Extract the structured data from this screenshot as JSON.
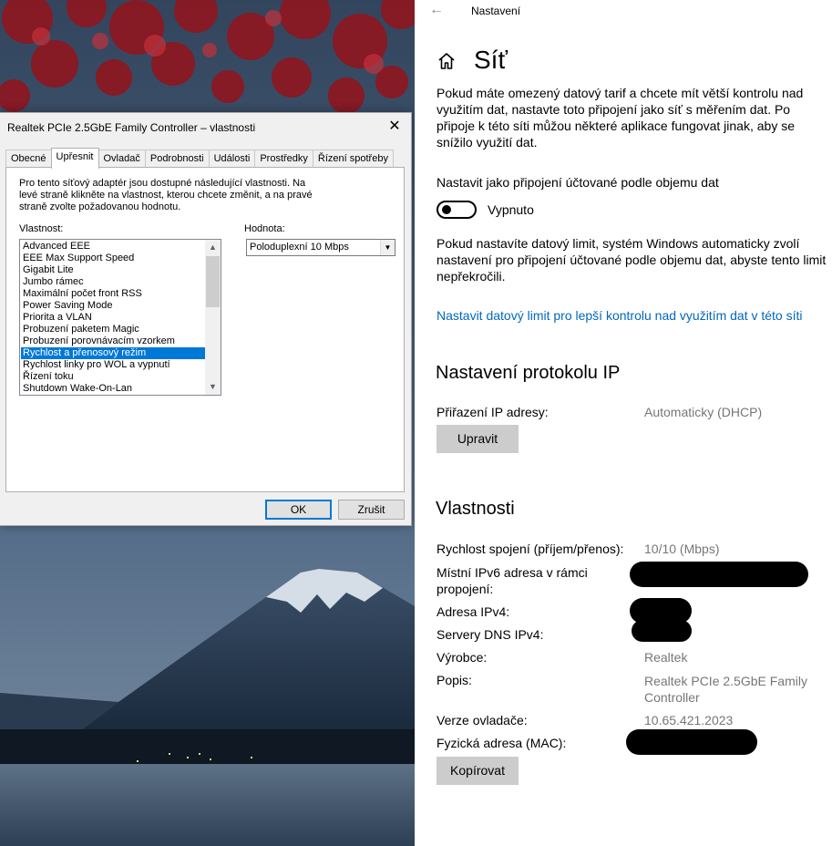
{
  "dialog": {
    "title": "Realtek PCIe 2.5GbE Family Controller – vlastnosti",
    "close_glyph": "✕",
    "tabs": [
      "Obecné",
      "Upřesnit",
      "Ovladač",
      "Podrobnosti",
      "Události",
      "Prostředky",
      "Řízení spotřeby"
    ],
    "active_tab": "Upřesnit",
    "description": "Pro tento síťový adaptér jsou dostupné následující vlastnosti. Na levé straně klikněte na vlastnost, kterou chcete změnit, a na pravé straně zvolte požadovanou hodnotu.",
    "property_label": "Vlastnost:",
    "value_label": "Hodnota:",
    "properties": [
      "Advanced EEE",
      "EEE Max Support Speed",
      "Gigabit Lite",
      "Jumbo rámec",
      "Maximální počet front RSS",
      "Power Saving Mode",
      "Priorita a VLAN",
      "Probuzení paketem Magic",
      "Probuzení porovnávacím vzorkem",
      "Rychlost a přenosový režim",
      "Rychlost linky pro WOL a vypnutí",
      "Řízení toku",
      "Shutdown Wake-On-Lan"
    ],
    "selected_property": "Rychlost a přenosový režim",
    "value": "Poloduplexní 10 Mbps",
    "ok_label": "OK",
    "cancel_label": "Zrušit"
  },
  "settings": {
    "app_title": "Nastavení",
    "back_glyph": "←",
    "page_title": "Síť",
    "intro": "Pokud máte omezený datový tarif a chcete mít větší kontrolu nad využitím dat, nastavte toto připojení jako síť s měřením dat. Po připoje k této síti můžou některé aplikace fungovat jinak, aby se snížilo využití dat.",
    "metered_label": "Nastavit jako připojení účtované podle objemu dat",
    "metered_state": "Vypnuto",
    "metered_on": false,
    "limit_text": "Pokud nastavíte datový limit, systém Windows automaticky zvolí nastavení pro připojení účtované podle objemu dat, abyste tento limit nepřekročili.",
    "limit_link": "Nastavit datový limit pro lepší kontrolu nad využitím dat v této síti",
    "ip_section": {
      "heading": "Nastavení protokolu IP",
      "assignment_label": "Přiřazení IP adresy:",
      "assignment_value": "Automaticky (DHCP)",
      "edit_button": "Upravit"
    },
    "properties_section": {
      "heading": "Vlastnosti",
      "speed_label": "Rychlost spojení (příjem/přenos):",
      "speed_value": "10/10 (Mbps)",
      "ipv6_label": "Místní IPv6 adresa v rámci propojení:",
      "ipv4_label": "Adresa IPv4:",
      "dns_label": "Servery DNS IPv4:",
      "manufacturer_label": "Výrobce:",
      "manufacturer_value": "Realtek",
      "description_label": "Popis:",
      "description_value": "Realtek PCIe 2.5GbE Family Controller",
      "driver_label": "Verze ovladače:",
      "driver_value": "10.65.421.2023",
      "mac_label": "Fyzická adresa (MAC):",
      "copy_button": "Kopírovat"
    }
  },
  "colors": {
    "accent": "#0078d7",
    "link": "#0067c0",
    "value_gray": "#767676"
  },
  "icons": [
    "back-arrow-icon",
    "home-icon",
    "close-icon",
    "scroll-up-icon",
    "scroll-down-icon",
    "dropdown-arrow-icon"
  ]
}
